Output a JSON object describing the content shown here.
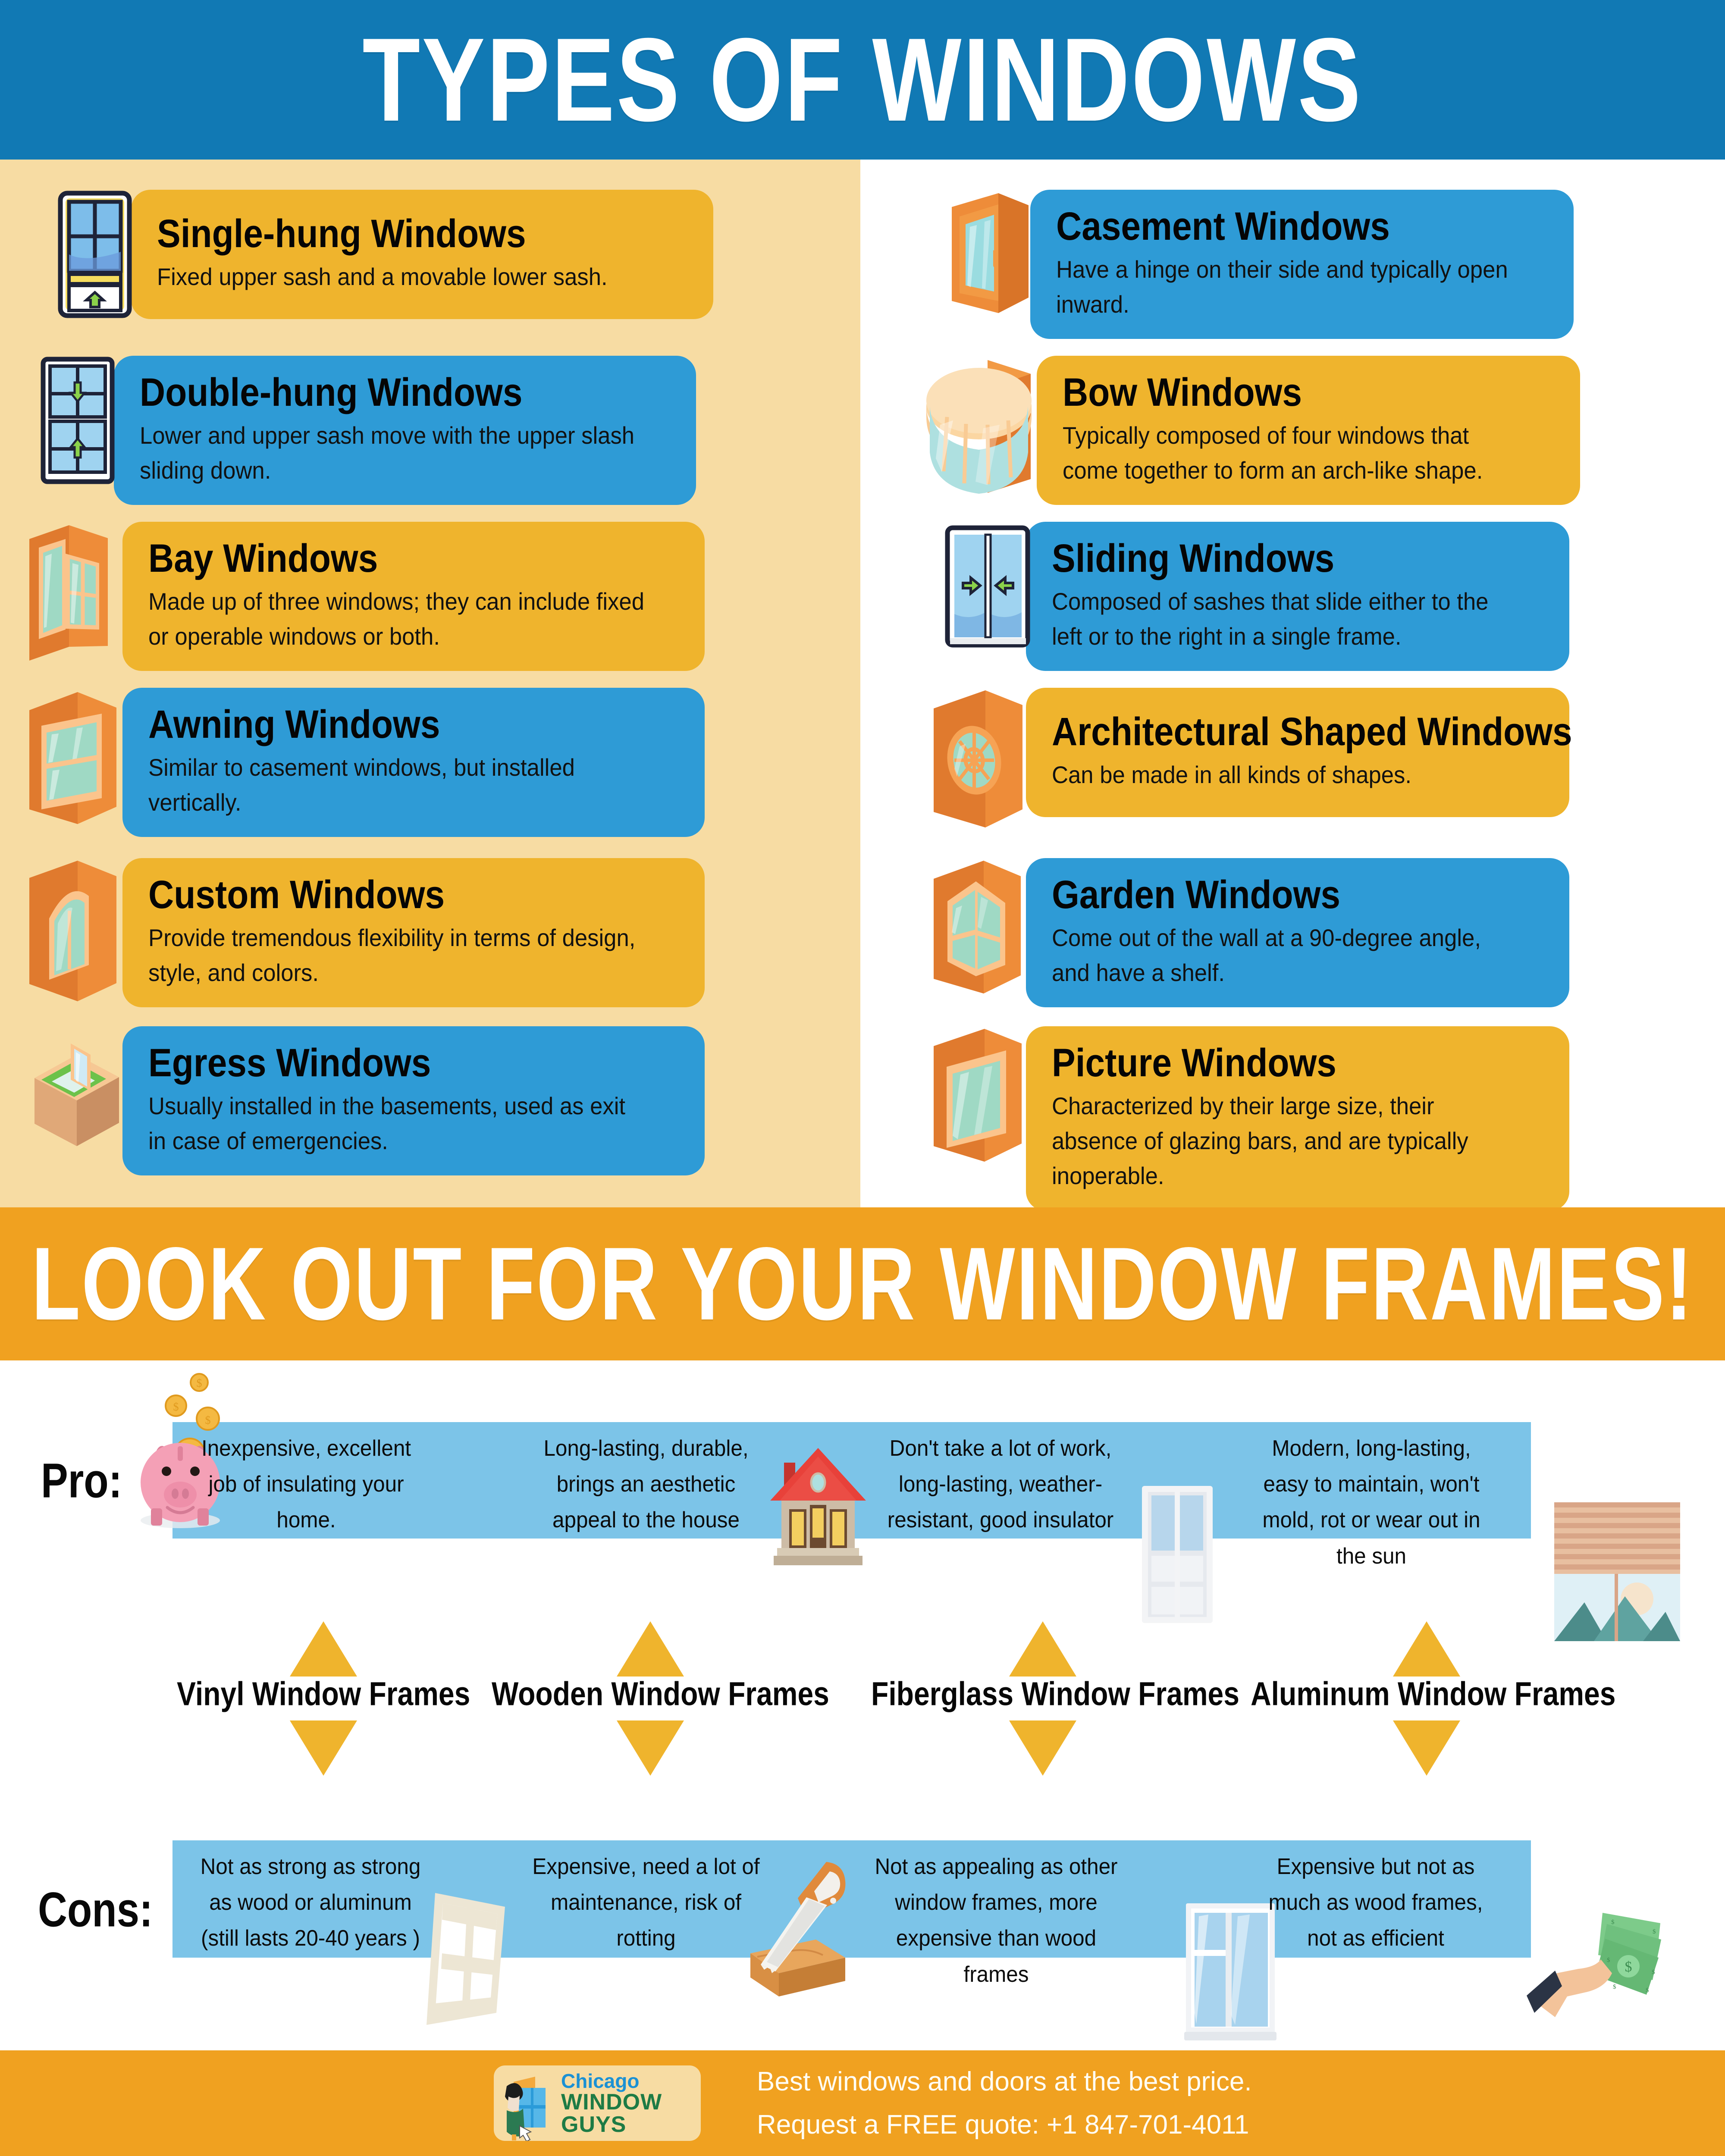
{
  "header": {
    "title": "TYPES OF WINDOWS",
    "bg_color": "#1179B4"
  },
  "colors": {
    "yellow_card": "#EFB42D",
    "blue_card": "#2E9BD6",
    "left_background": "#F7DCA3",
    "orange_banner": "#F0A120",
    "strip_blue": "#7CC4E8",
    "header_blue": "#1179B4"
  },
  "types": {
    "left_column": [
      {
        "title": "Single-hung Windows",
        "desc": "Fixed upper sash and a movable lower sash.",
        "card_color": "yellow",
        "icon": "single-hung-window-icon"
      },
      {
        "title": "Double-hung Windows",
        "desc": "Lower and upper sash move with the upper slash sliding down.",
        "card_color": "blue",
        "icon": "double-hung-window-icon"
      },
      {
        "title": "Bay Windows",
        "desc": "Made up of three windows; they can include fixed or operable windows or both.",
        "card_color": "yellow",
        "icon": "bay-window-icon"
      },
      {
        "title": "Awning Windows",
        "desc": "Similar to casement windows, but installed vertically.",
        "card_color": "blue",
        "icon": "awning-window-icon"
      },
      {
        "title": "Custom Windows",
        "desc": "Provide tremendous flexibility in terms of design, style, and colors.",
        "card_color": "yellow",
        "icon": "custom-arched-window-icon"
      },
      {
        "title": "Egress Windows",
        "desc": "Usually installed in the basements, used as exit in case of emergencies.",
        "card_color": "blue",
        "icon": "egress-window-icon"
      }
    ],
    "right_column": [
      {
        "title": "Casement Windows",
        "desc": "Have a hinge on their side and typically open inward.",
        "card_color": "blue",
        "icon": "casement-window-icon"
      },
      {
        "title": "Bow Windows",
        "desc": "Typically composed of four windows that come together to form an arch-like shape.",
        "card_color": "yellow",
        "icon": "bow-window-icon"
      },
      {
        "title": "Sliding Windows",
        "desc": "Composed of sashes that slide either to the left or to the right in a single frame.",
        "card_color": "blue",
        "icon": "sliding-window-icon"
      },
      {
        "title": "Architectural Shaped Windows",
        "desc": "Can be made in all kinds of shapes.",
        "card_color": "yellow",
        "icon": "round-architectural-window-icon"
      },
      {
        "title": "Garden Windows",
        "desc": "Come out of the wall at a 90-degree angle, and have a shelf.",
        "card_color": "blue",
        "icon": "garden-window-icon"
      },
      {
        "title": "Picture Windows",
        "desc": "Characterized by their large size, their absence of glazing bars, and are typically inoperable.",
        "card_color": "yellow",
        "icon": "picture-window-icon"
      }
    ]
  },
  "frames_banner": {
    "title": "LOOK OUT FOR YOUR WINDOW FRAMES!"
  },
  "compare": {
    "pro_label": "Pro:",
    "cons_label": "Cons:",
    "frames": [
      {
        "name": "Vinyl Window Frames",
        "pro": "Inexpensive, excellent job of insulating your home.",
        "con": "Not as strong as strong as wood or aluminum (still lasts 20-40 years )",
        "pro_icon": "piggy-bank-icon",
        "con_icon": "white-window-icon"
      },
      {
        "name": "Wooden Window Frames",
        "pro": "Long-lasting, durable, brings an aesthetic appeal to the house",
        "con": "Expensive, need a lot of maintenance, risk of rotting",
        "pro_icon": "house-icon",
        "con_icon": "handsaw-and-wood-icon"
      },
      {
        "name": "Fiberglass Window Frames",
        "pro": "Don't take a lot of work, long-lasting, weather-resistant, good insulator",
        "con": "Not as appealing as other window frames, more expensive than wood frames",
        "pro_icon": "fiberglass-window-icon",
        "con_icon": "sliding-glass-door-icon"
      },
      {
        "name": "Aluminum Window Frames",
        "pro": "Modern, long-lasting, easy to maintain, won't mold, rot or wear out in the sun",
        "con": "Expensive but not as much as wood frames, not as efficient",
        "pro_icon": "blinds-window-icon",
        "con_icon": "hand-holding-money-icon"
      }
    ]
  },
  "footer": {
    "logo_line1": "Chicago",
    "logo_line2": "WINDOW GUYS",
    "tagline_line1": "Best windows and doors at the best price.",
    "tagline_line2": "Request a FREE quote: +1 847-701-4011"
  }
}
